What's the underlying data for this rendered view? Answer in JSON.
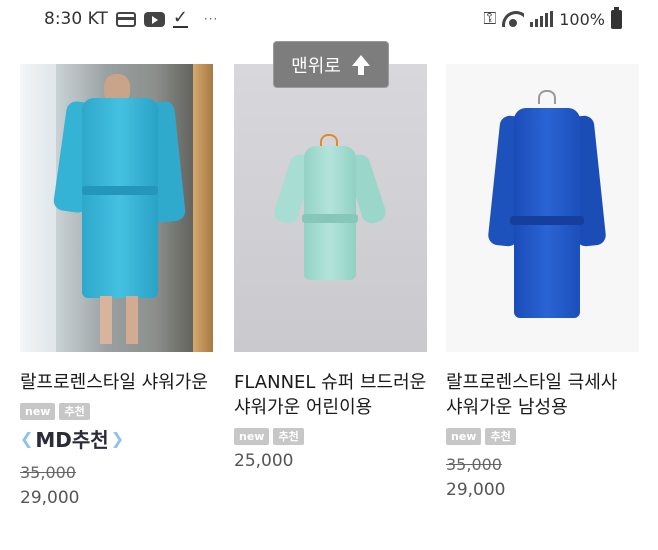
{
  "status_bar": {
    "time": "8:30",
    "carrier": "KT",
    "more": "···",
    "battery_text": "100%"
  },
  "top_button": {
    "label": "맨위로"
  },
  "products": [
    {
      "name": "랄프로렌스타일 샤워가운",
      "badges": [
        "new",
        "추천"
      ],
      "md_pick": "MD추천",
      "price_original": "35,000",
      "price_sale": "29,000",
      "color": "#3fb6d6"
    },
    {
      "name": "FLANNEL 슈퍼 브드러운 샤워가운 어린이용",
      "badges": [
        "new",
        "추천"
      ],
      "price_sale": "25,000",
      "color": "#9fd8cc"
    },
    {
      "name": "랄프로렌스타일 극세사 샤워가운 남성용",
      "badges": [
        "new",
        "추천"
      ],
      "price_original": "35,000",
      "price_sale": "29,000",
      "color": "#1f56c2"
    }
  ]
}
